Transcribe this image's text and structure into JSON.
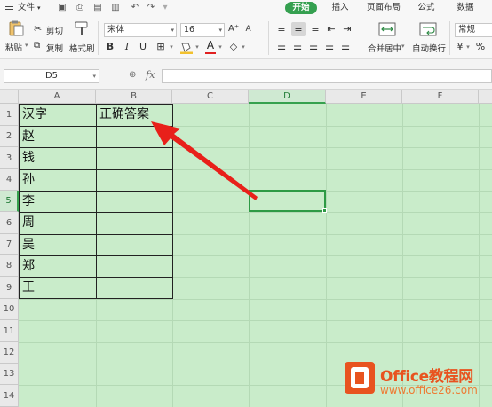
{
  "menu": {
    "file": "文件",
    "tabs": [
      {
        "label": "开始",
        "active": true
      },
      {
        "label": "插入",
        "active": false
      },
      {
        "label": "页面布局",
        "active": false
      },
      {
        "label": "公式",
        "active": false
      },
      {
        "label": "数据",
        "active": false
      }
    ]
  },
  "ribbon": {
    "paste": "粘贴",
    "cut": "剪切",
    "copy": "复制",
    "format_painter": "格式刷",
    "font_name": "宋体",
    "font_size": "16",
    "bold": "B",
    "italic": "I",
    "underline": "U",
    "merge_center": "合并居中",
    "wrap_text": "自动换行",
    "number_format": "常规"
  },
  "formula_bar": {
    "name_box": "D5",
    "fx": "fx",
    "formula": ""
  },
  "sheet": {
    "columns": [
      "A",
      "B",
      "C",
      "D",
      "E",
      "F"
    ],
    "selected_column": "D",
    "rows": [
      "1",
      "2",
      "3",
      "4",
      "5",
      "6",
      "7",
      "8",
      "9",
      "10",
      "11",
      "12",
      "13",
      "14"
    ],
    "selected_row": "5",
    "cells": {
      "A1": "汉字",
      "B1": "正确答案",
      "A2": "赵",
      "A3": "钱",
      "A4": "孙",
      "A5": "李",
      "A6": "周",
      "A7": "吴",
      "A8": "郑",
      "A9": "王"
    },
    "grid_color": "#c9ecca",
    "annotation_arrow_color": "#e8201a"
  },
  "watermark": {
    "title": "Office教程网",
    "url": "www.office26.com"
  }
}
